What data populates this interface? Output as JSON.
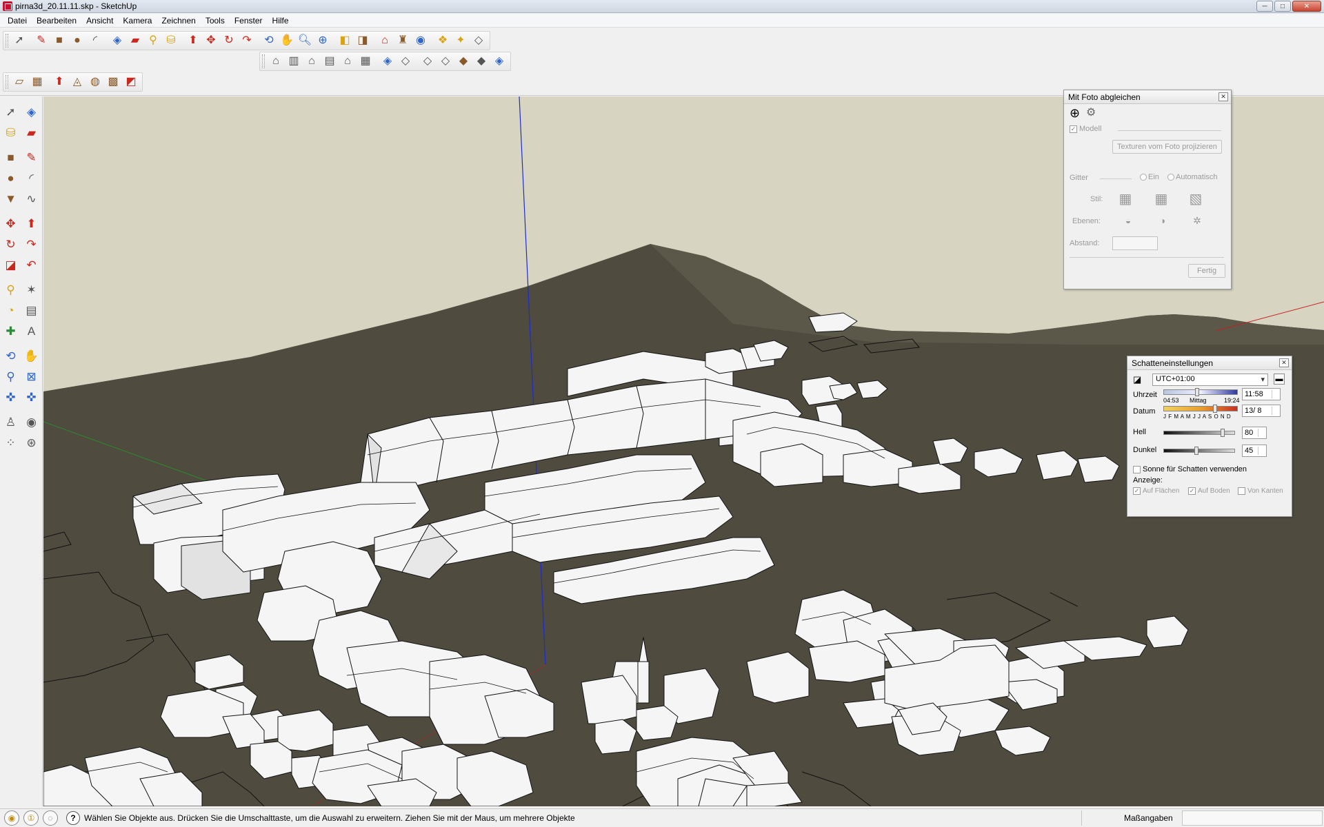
{
  "window": {
    "title": "pirna3d_20.11.11.skp - SketchUp",
    "minimize": "─",
    "maximize": "□",
    "close": "✕"
  },
  "menu": [
    "Datei",
    "Bearbeiten",
    "Ansicht",
    "Kamera",
    "Zeichnen",
    "Tools",
    "Fenster",
    "Hilfe"
  ],
  "toolbars": {
    "standard_icons": [
      "select-arrow-icon",
      "pencil-icon",
      "rectangle-icon",
      "circle-icon",
      "arc-icon",
      "make-component-icon",
      "eraser-icon",
      "tape-measure-icon",
      "paint-bucket-icon",
      "push-pull-icon",
      "move-icon",
      "rotate-icon",
      "follow-me-icon",
      "orbit-icon",
      "pan-icon",
      "zoom-icon",
      "zoom-extents-icon",
      "previous-scene-icon",
      "next-scene-icon",
      "add-location-icon",
      "toggle-terrain-icon",
      "google-earth-icon",
      "get-models-icon",
      "share-model-icon",
      "share-component-icon"
    ],
    "views_icons": [
      "iso-view-icon",
      "top-view-icon",
      "front-view-icon",
      "right-view-icon",
      "back-view-icon",
      "left-view-icon",
      "xray-icon",
      "wireframe-icon",
      "hidden-line-icon",
      "shaded-icon",
      "shaded-textures-icon",
      "monochrome-icon"
    ],
    "sandbox_icons": [
      "sandbox-from-contours-icon",
      "sandbox-from-scratch-icon",
      "smoove-icon",
      "stamp-icon",
      "drape-icon",
      "add-detail-icon",
      "flip-edge-icon"
    ]
  },
  "match_photo": {
    "title": "Mit Foto abgleichen",
    "model_label": "Modell",
    "project_button": "Texturen vom Foto projizieren",
    "grid_label": "Gitter",
    "grid_on": "Ein",
    "grid_auto": "Automatisch",
    "style_label": "Stil:",
    "planes_label": "Ebenen:",
    "spacing_label": "Abstand:",
    "done_button": "Fertig"
  },
  "shadow_settings": {
    "title": "Schatteneinstellungen",
    "timezone": "UTC+01:00",
    "time_label": "Uhrzeit",
    "time_start": "04:53",
    "time_mid": "Mittag",
    "time_end": "19:24",
    "time_value": "11:58",
    "date_label": "Datum",
    "months": "J F M A M J J A S O N D",
    "date_value": "13/ 8",
    "light_label": "Hell",
    "light_value": "80",
    "light_fraction": 0.8,
    "dark_label": "Dunkel",
    "dark_value": "45",
    "dark_fraction": 0.45,
    "sun_shadows_label": "Sonne für Schatten verwenden",
    "display_label": "Anzeige:",
    "on_faces": "Auf Flächen",
    "on_ground": "Auf Boden",
    "from_edges": "Von Kanten"
  },
  "status": {
    "message": "Wählen Sie Objekte aus. Drücken Sie die Umschalttaste, um die Auswahl zu erweitern. Ziehen Sie mit der Maus, um mehrere Objekte",
    "measurements_label": "Maßangaben",
    "help": "?"
  },
  "colors": {
    "sky": "#d7d5c2",
    "ground": "#4f4c3f",
    "building": "#f5f5f5",
    "axis_blue": "#1b2bd0",
    "axis_red": "#c81e1e",
    "axis_green": "#2a8a2a"
  }
}
